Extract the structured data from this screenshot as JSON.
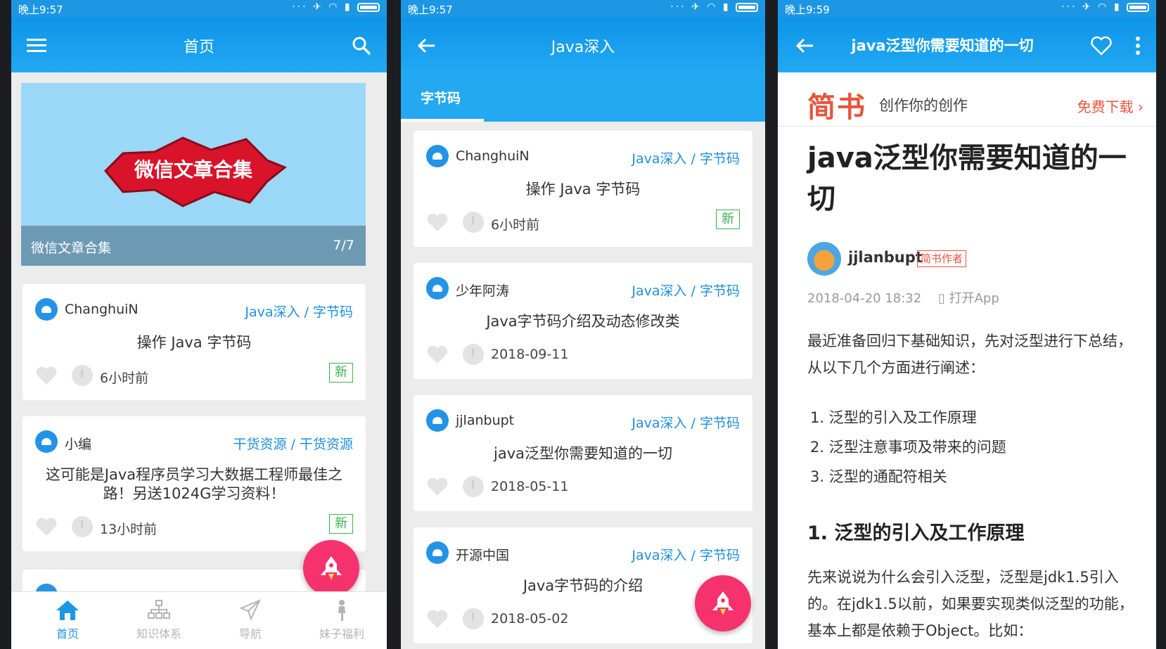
{
  "screen1": {
    "status": {
      "time": "晚上9:57"
    },
    "toolbar": {
      "title": "首页"
    },
    "banner": {
      "caption": "微信文章合集",
      "page": "7/7",
      "image_text": "微信文章合集"
    },
    "cards": [
      {
        "author": "ChanghuiN",
        "chapter": "Java深入 / 字节码",
        "title": "操作 Java 字节码",
        "time": "6小时前",
        "badge": "新"
      },
      {
        "author": "小编",
        "chapter": "干货资源 / 干货资源",
        "title": "这可能是Java程序员学习大数据工程师最佳之路！另送1024G学习资料！",
        "time": "13小时前",
        "badge": "新"
      }
    ],
    "nav": [
      {
        "label": "首页"
      },
      {
        "label": "知识体系"
      },
      {
        "label": "导航"
      },
      {
        "label": "妹子福利"
      }
    ]
  },
  "screen2": {
    "status": {
      "time": "晚上9:57"
    },
    "toolbar": {
      "title": "Java深入"
    },
    "tab": {
      "label": "字节码"
    },
    "cards": [
      {
        "author": "ChanghuiN",
        "chapter": "Java深入 / 字节码",
        "title": "操作 Java 字节码",
        "time": "6小时前",
        "badge": "新"
      },
      {
        "author": "少年阿涛",
        "chapter": "Java深入 / 字节码",
        "title": "Java字节码介绍及动态修改类",
        "time": "2018-09-11"
      },
      {
        "author": "jjlanbupt",
        "chapter": "Java深入 / 字节码",
        "title": "java泛型你需要知道的一切",
        "time": "2018-05-11"
      },
      {
        "author": "开源中国",
        "chapter": "Java深入 / 字节码",
        "title": "Java字节码的介绍",
        "time": "2018-05-02"
      }
    ]
  },
  "screen3": {
    "status": {
      "time": "晚上9:59"
    },
    "toolbar": {
      "title": "java泛型你需要知道的一切"
    },
    "promo": {
      "logo": "简书",
      "slogan": "创作你的创作",
      "download": "免费下载 ›"
    },
    "article": {
      "title": "java泛型你需要知道的一切",
      "author": "jjlanbupt",
      "author_badge": "简书作者",
      "date": "2018-04-20 18:32",
      "open_app": "打开App",
      "intro": "最近准备回归下基础知识，先对泛型进行下总结，从以下几个方面进行阐述：",
      "list": [
        "1. 泛型的引入及工作原理",
        "2. 泛型注意事项及带来的问题",
        "3. 泛型的通配符相关"
      ],
      "heading": "1. 泛型的引入及工作原理",
      "para2": "先来说说为什么会引入泛型，泛型是jdk1.5引入的。在jdk1.5以前，如果要实现类似泛型的功能，基本上都是依赖于Object。比如："
    }
  },
  "colors": {
    "primary": "#1d97e3",
    "accent": "#f5326e",
    "new_badge": "#3ab24a",
    "jianshu_red": "#e8543c"
  }
}
